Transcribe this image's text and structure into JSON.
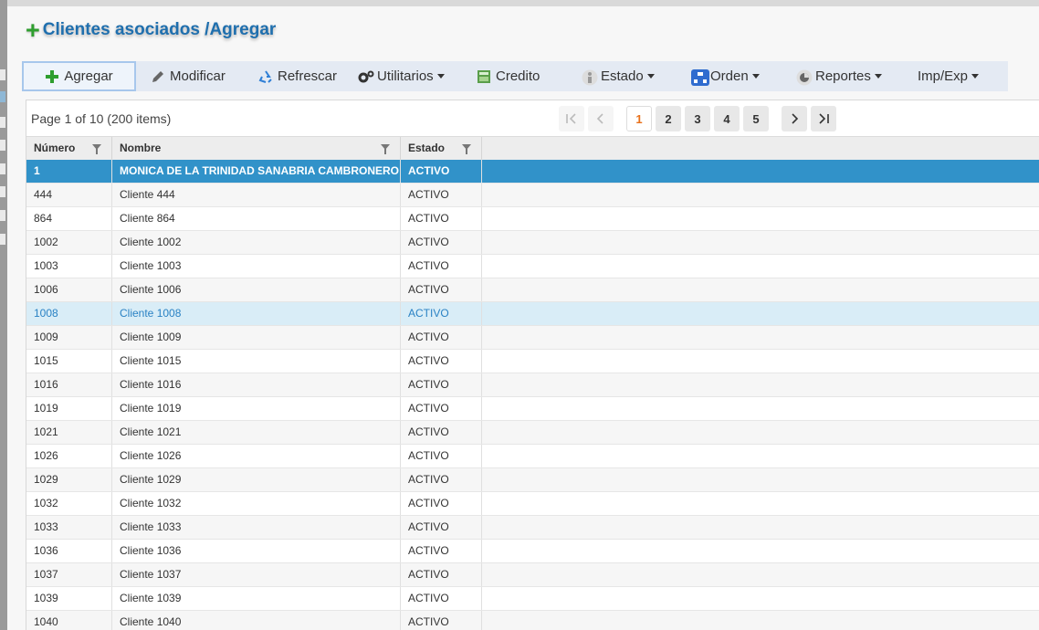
{
  "dialog": {
    "title": "Clientes asociados /Agregar"
  },
  "toolbar": {
    "items": [
      {
        "label": "Agregar",
        "icon": "plus-icon"
      },
      {
        "label": "Modificar",
        "icon": "pencil-icon"
      },
      {
        "label": "Refrescar",
        "icon": "recycle-icon"
      },
      {
        "label": "Utilitarios",
        "icon": "gears-icon"
      },
      {
        "label": "Credito",
        "icon": "calculator-icon"
      },
      {
        "label": "Estado",
        "icon": "person-icon"
      },
      {
        "label": "Orden",
        "icon": "sitemap-icon"
      },
      {
        "label": "Reportes",
        "icon": "pie-chart-icon"
      },
      {
        "label": "Imp/Exp",
        "icon": ""
      }
    ]
  },
  "pager": {
    "info": "Page 1 of 10 (200 items)",
    "pages": [
      "1",
      "2",
      "3",
      "4",
      "5"
    ],
    "current": "1"
  },
  "table": {
    "columns": [
      "Número",
      "Nombre",
      "Estado"
    ],
    "rows": [
      [
        "1",
        "MONICA DE LA TRINIDAD SANABRIA CAMBRONERO",
        "ACTIVO"
      ],
      [
        "444",
        "Cliente 444",
        "ACTIVO"
      ],
      [
        "864",
        "Cliente 864",
        "ACTIVO"
      ],
      [
        "1002",
        "Cliente 1002",
        "ACTIVO"
      ],
      [
        "1003",
        "Cliente 1003",
        "ACTIVO"
      ],
      [
        "1006",
        "Cliente 1006",
        "ACTIVO"
      ],
      [
        "1008",
        "Cliente 1008",
        "ACTIVO"
      ],
      [
        "1009",
        "Cliente 1009",
        "ACTIVO"
      ],
      [
        "1015",
        "Cliente 1015",
        "ACTIVO"
      ],
      [
        "1016",
        "Cliente 1016",
        "ACTIVO"
      ],
      [
        "1019",
        "Cliente 1019",
        "ACTIVO"
      ],
      [
        "1021",
        "Cliente 1021",
        "ACTIVO"
      ],
      [
        "1026",
        "Cliente 1026",
        "ACTIVO"
      ],
      [
        "1029",
        "Cliente 1029",
        "ACTIVO"
      ],
      [
        "1032",
        "Cliente 1032",
        "ACTIVO"
      ],
      [
        "1033",
        "Cliente 1033",
        "ACTIVO"
      ],
      [
        "1036",
        "Cliente 1036",
        "ACTIVO"
      ],
      [
        "1037",
        "Cliente 1037",
        "ACTIVO"
      ],
      [
        "1039",
        "Cliente 1039",
        "ACTIVO"
      ],
      [
        "1040",
        "Cliente 1040",
        "ACTIVO"
      ]
    ],
    "selected_row": "1",
    "hovered_row": "1008"
  },
  "colors": {
    "title": "#1f6fae",
    "plus": "#2e9e2e",
    "selected_row": "#3192c9",
    "hover_row": "#d9edf7",
    "current_page": "#e8711b"
  }
}
